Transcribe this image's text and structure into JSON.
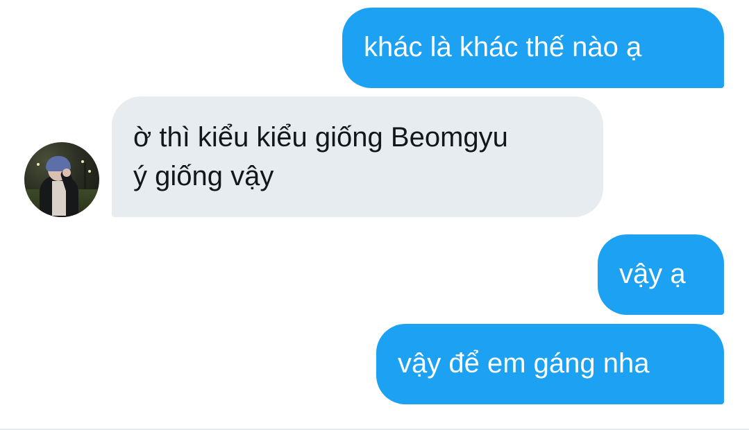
{
  "conversation": {
    "messages": [
      {
        "direction": "sent",
        "lines": [
          "khác là khác thế nào ạ"
        ]
      },
      {
        "direction": "received",
        "lines": [
          "ờ thì kiểu kiểu giống Beomgyu",
          "ý giống vậy"
        ]
      },
      {
        "direction": "sent",
        "lines": [
          "vậy ạ"
        ]
      },
      {
        "direction": "sent",
        "lines": [
          "vậy để em gáng nha"
        ]
      }
    ]
  },
  "colors": {
    "sent_bubble": "#1da1f2",
    "received_bubble": "#e6ecf0",
    "sent_text": "#ffffff",
    "received_text": "#14171a"
  }
}
